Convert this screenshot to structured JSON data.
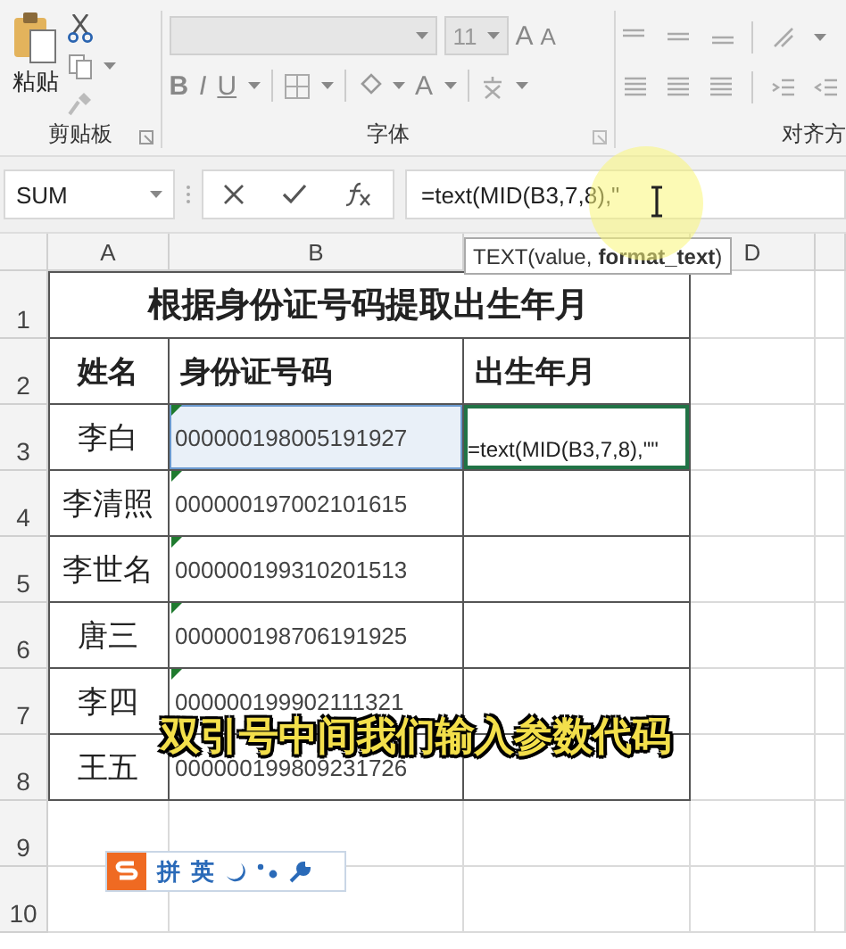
{
  "ribbon": {
    "paste_label": "粘贴",
    "font_size": "11",
    "grow_font": "A",
    "shrink_font": "A",
    "format_buttons": [
      "B",
      "I",
      "U"
    ],
    "font_color": "A",
    "groups": [
      {
        "label": "剪贴板"
      },
      {
        "label": "字体"
      },
      {
        "label": "对齐方"
      }
    ]
  },
  "formula_bar": {
    "name_box": "SUM",
    "formula": "=text(MID(B3,7,8),\""
  },
  "tooltip": {
    "parts": [
      {
        "text": "TEXT(value,",
        "bold": false
      },
      {
        "text": "format_text",
        "bold": true
      },
      {
        "text": ")",
        "bold": false
      }
    ]
  },
  "sheet": {
    "columns": [
      "A",
      "B",
      null,
      "D",
      null
    ],
    "row_numbers": [
      "1",
      "2",
      "3",
      "4",
      "5",
      "6",
      "7",
      "8",
      "9",
      "10"
    ],
    "title": "根据身份证号码提取出生年月",
    "headers": [
      "姓名",
      "身份证号码",
      "出生年月"
    ],
    "records": [
      {
        "name": "李白",
        "id": "000000198005191927",
        "result": "=text(MID(B3,7,8),\"\"",
        "selected": true,
        "referenced": true,
        "text_number_flag": true
      },
      {
        "name": "李清照",
        "id": "000000197002101615",
        "selected": false,
        "referenced": false,
        "text_number_flag": true
      },
      {
        "name": "李世名",
        "id": "000000199310201513",
        "selected": false,
        "referenced": false,
        "text_number_flag": true
      },
      {
        "name": "唐三",
        "id": "000000198706191925",
        "selected": false,
        "referenced": false,
        "text_number_flag": true
      },
      {
        "name": "李四",
        "id": "000000199902111321",
        "selected": false,
        "referenced": false,
        "text_number_flag": true
      },
      {
        "name": "王五",
        "id": "000000199809231726",
        "selected": false,
        "referenced": false,
        "text_number_flag": false
      }
    ]
  },
  "subtitle": "双引号中间我们输入参数代码",
  "ime_bar": {
    "labels": [
      "拼",
      "英"
    ]
  }
}
